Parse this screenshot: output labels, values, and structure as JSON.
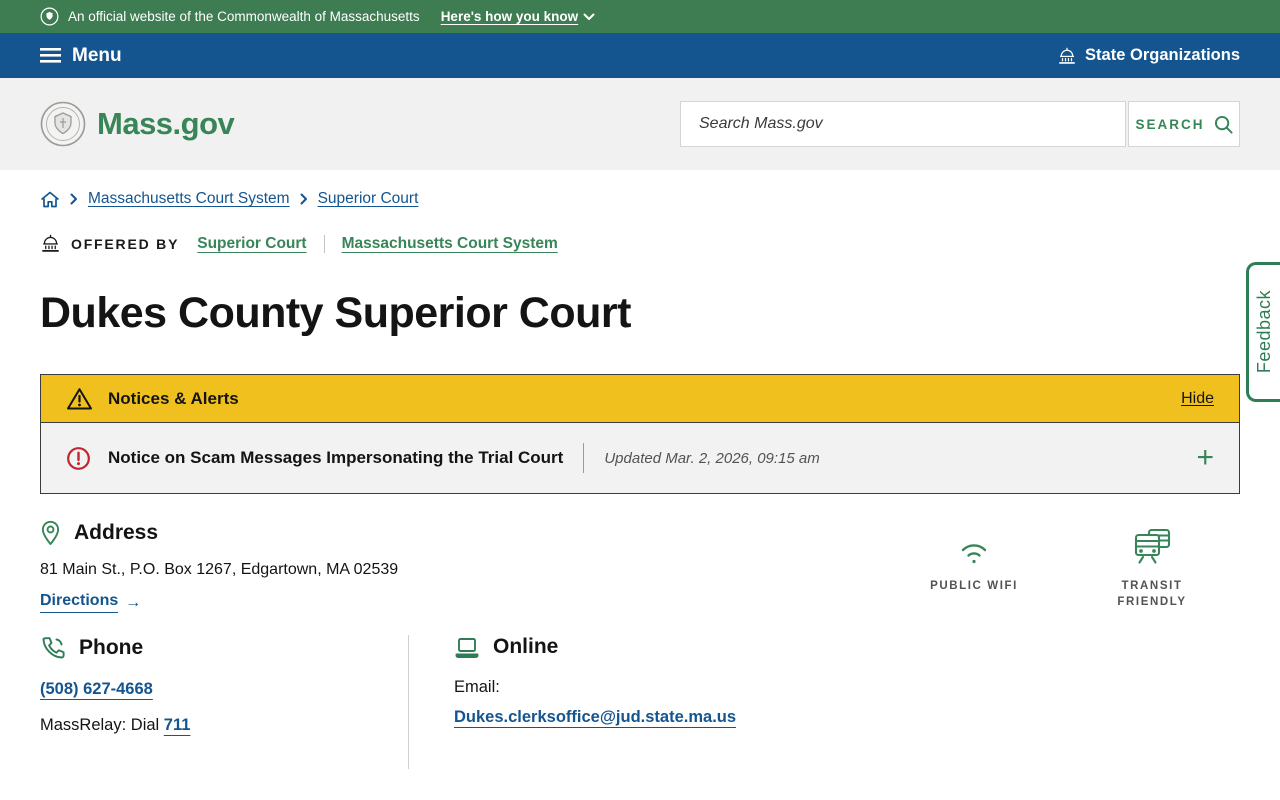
{
  "banner": {
    "text": "An official website of the Commonwealth of Massachusetts",
    "link_label": "Here's how you know"
  },
  "nav": {
    "menu_label": "Menu",
    "state_organizations_label": "State Organizations"
  },
  "header": {
    "logo_text": "Mass.gov",
    "search_placeholder": "Search Mass.gov",
    "search_button_label": "SEARCH"
  },
  "breadcrumb": {
    "items": [
      "Massachusetts Court System",
      "Superior Court"
    ]
  },
  "offered_by": {
    "label": "OFFERED BY",
    "links": [
      "Superior Court",
      "Massachusetts Court System"
    ]
  },
  "page": {
    "title": "Dukes County Superior Court"
  },
  "alerts": {
    "title": "Notices & Alerts",
    "hide_label": "Hide",
    "notice_title": "Notice on Scam Messages Impersonating the Trial Court",
    "notice_updated": "Updated Mar. 2, 2026, 09:15 am",
    "expand_symbol": "+"
  },
  "address": {
    "heading": "Address",
    "line": "81 Main St., P.O. Box 1267, Edgartown, MA 02539",
    "directions_label": "Directions",
    "directions_arrow": "→"
  },
  "amenities": [
    {
      "label": "PUBLIC WIFI"
    },
    {
      "label": "TRANSIT FRIENDLY"
    }
  ],
  "phone": {
    "heading": "Phone",
    "number": "(508) 627-4668",
    "massrelay_prefix": "MassRelay: Dial ",
    "massrelay_number": "711"
  },
  "online": {
    "heading": "Online",
    "email_label": "Email:",
    "email_address": "Dukes.clerksoffice@jud.state.ma.us"
  },
  "feedback": {
    "label": "Feedback"
  },
  "colors": {
    "banner_green": "#3e7c52",
    "brand_green": "#388557",
    "primary_blue": "#14558f",
    "alert_gold": "#f0c11e",
    "alert_red": "#c2252e",
    "feedback_green": "#2f7d57"
  }
}
